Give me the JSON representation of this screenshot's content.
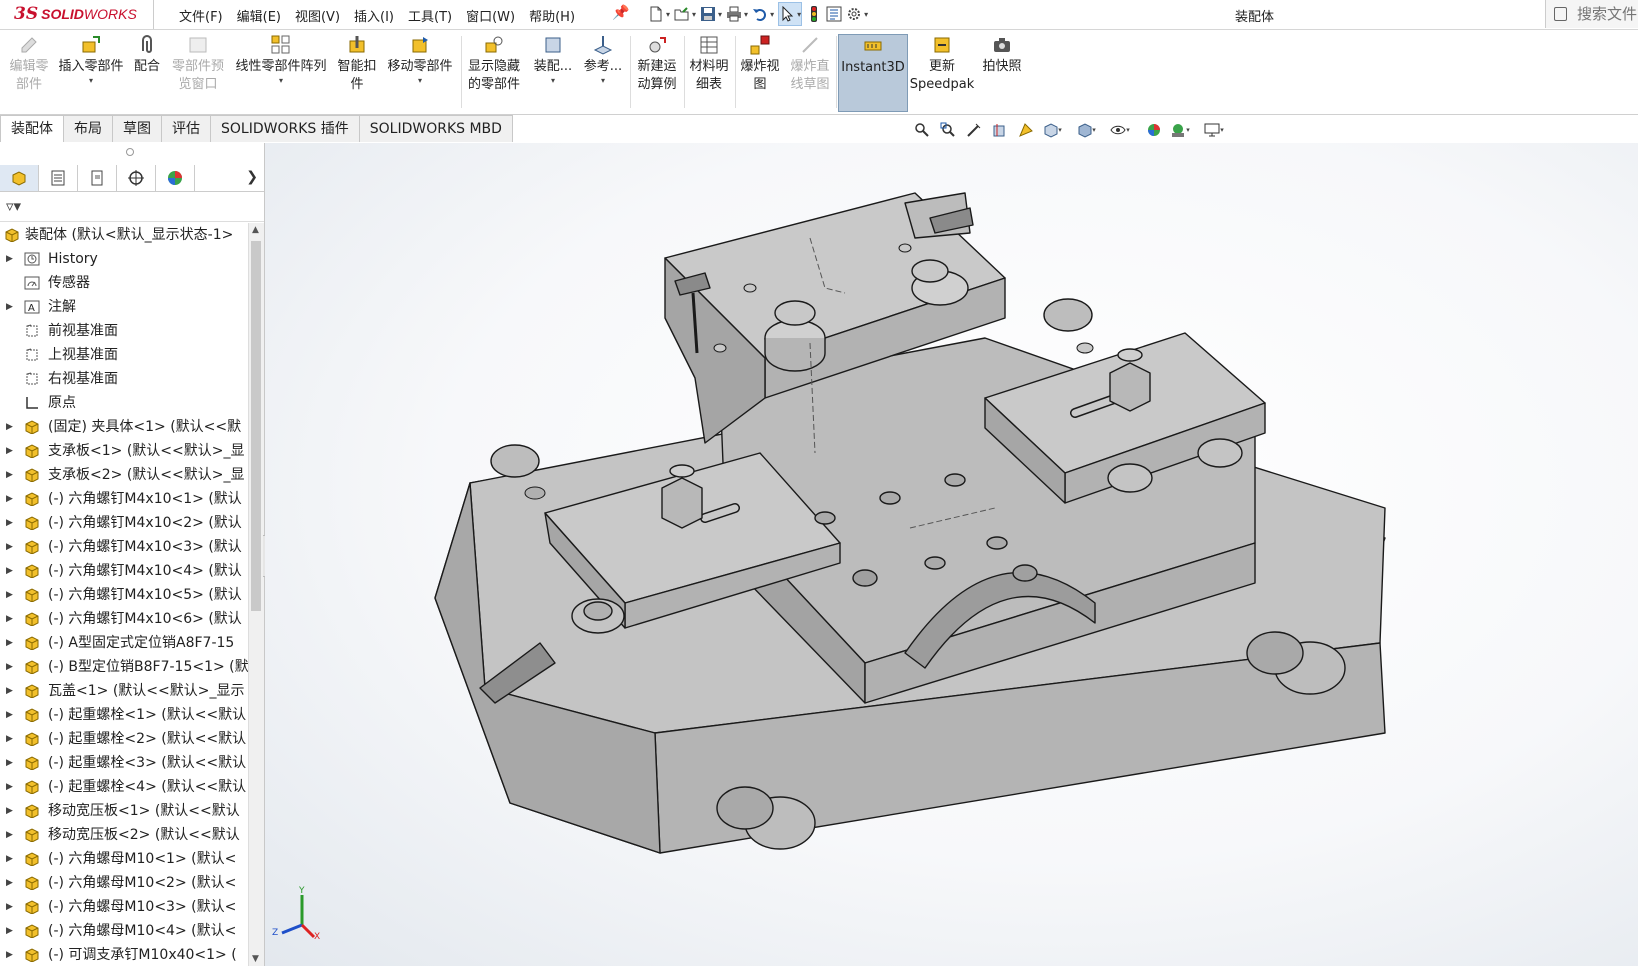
{
  "app": {
    "logo_ds": "3S",
    "logo_solid": "SOLID",
    "logo_works": "WORKS",
    "document_title": "装配体",
    "search_placeholder": "搜索文件"
  },
  "menu": [
    "文件(F)",
    "编辑(E)",
    "视图(V)",
    "插入(I)",
    "工具(T)",
    "窗口(W)",
    "帮助(H)"
  ],
  "quick_access": [
    {
      "name": "new-document-icon"
    },
    {
      "name": "open-icon"
    },
    {
      "name": "save-icon"
    },
    {
      "name": "print-icon"
    },
    {
      "name": "undo-icon"
    },
    {
      "name": "select-cursor-icon"
    },
    {
      "name": "rebuild-traffic-light-icon"
    },
    {
      "name": "file-properties-icon"
    },
    {
      "name": "options-gear-icon"
    }
  ],
  "ribbon": {
    "edit_component": [
      "编辑零",
      "部件"
    ],
    "insert_component": "插入零部件",
    "mate": "配合",
    "component_preview": [
      "零部件预",
      "览窗口"
    ],
    "linear_pattern": "线性零部件阵列",
    "smart_fasteners": [
      "智能扣",
      "件"
    ],
    "move_component": "移动零部件",
    "show_hidden": [
      "显示隐藏",
      "的零部件"
    ],
    "assembly_features": "装配...",
    "reference_geometry": "参考...",
    "new_motion_study": [
      "新建运",
      "动算例"
    ],
    "bill_of_materials": [
      "材料明",
      "细表"
    ],
    "exploded_view": [
      "爆炸视",
      "图"
    ],
    "explode_line_sketch": [
      "爆炸直",
      "线草图"
    ],
    "instant3d": "Instant3D",
    "update_speedpak": [
      "更新",
      "Speedpak"
    ],
    "take_snapshot": "拍快照"
  },
  "tabs": [
    "装配体",
    "布局",
    "草图",
    "评估",
    "SOLIDWORKS 插件",
    "SOLIDWORKS MBD"
  ],
  "tree": {
    "root": "装配体 (默认<默认_显示状态-1>",
    "items": [
      {
        "label": "History",
        "icon": "history-icon",
        "expandable": true
      },
      {
        "label": "传感器",
        "icon": "sensor-icon",
        "expandable": false
      },
      {
        "label": "注解",
        "icon": "annotation-icon",
        "expandable": true
      },
      {
        "label": "前视基准面",
        "icon": "plane-icon",
        "expandable": false
      },
      {
        "label": "上视基准面",
        "icon": "plane-icon",
        "expandable": false
      },
      {
        "label": "右视基准面",
        "icon": "plane-icon",
        "expandable": false
      },
      {
        "label": "原点",
        "icon": "origin-icon",
        "expandable": false
      },
      {
        "label": "(固定) 夹具体<1> (默认<<默",
        "icon": "part-icon",
        "expandable": true
      },
      {
        "label": "支承板<1> (默认<<默认>_显",
        "icon": "part-icon",
        "expandable": true
      },
      {
        "label": "支承板<2> (默认<<默认>_显",
        "icon": "part-icon",
        "expandable": true
      },
      {
        "label": "(-) 六角螺钉M4x10<1> (默认",
        "icon": "part-icon",
        "expandable": true
      },
      {
        "label": "(-) 六角螺钉M4x10<2> (默认",
        "icon": "part-icon",
        "expandable": true
      },
      {
        "label": "(-) 六角螺钉M4x10<3> (默认",
        "icon": "part-icon",
        "expandable": true
      },
      {
        "label": "(-) 六角螺钉M4x10<4> (默认",
        "icon": "part-icon",
        "expandable": true
      },
      {
        "label": "(-) 六角螺钉M4x10<5> (默认",
        "icon": "part-icon",
        "expandable": true
      },
      {
        "label": "(-) 六角螺钉M4x10<6> (默认",
        "icon": "part-icon",
        "expandable": true
      },
      {
        "label": "(-) A型固定式定位销A8F7-15",
        "icon": "part-icon",
        "expandable": true
      },
      {
        "label": "(-) B型定位销B8F7-15<1> (默",
        "icon": "part-icon",
        "expandable": true
      },
      {
        "label": "瓦盖<1> (默认<<默认>_显示",
        "icon": "part-icon",
        "expandable": true
      },
      {
        "label": "(-) 起重螺栓<1> (默认<<默认",
        "icon": "part-icon",
        "expandable": true
      },
      {
        "label": "(-) 起重螺栓<2> (默认<<默认",
        "icon": "part-icon",
        "expandable": true
      },
      {
        "label": "(-) 起重螺栓<3> (默认<<默认",
        "icon": "part-icon",
        "expandable": true
      },
      {
        "label": "(-) 起重螺栓<4> (默认<<默认",
        "icon": "part-icon",
        "expandable": true
      },
      {
        "label": "移动宽压板<1> (默认<<默认",
        "icon": "part-icon",
        "expandable": true
      },
      {
        "label": "移动宽压板<2> (默认<<默认",
        "icon": "part-icon",
        "expandable": true
      },
      {
        "label": "(-) 六角螺母M10<1> (默认<",
        "icon": "part-icon",
        "expandable": true
      },
      {
        "label": "(-) 六角螺母M10<2> (默认<",
        "icon": "part-icon",
        "expandable": true
      },
      {
        "label": "(-) 六角螺母M10<3> (默认<",
        "icon": "part-icon",
        "expandable": true
      },
      {
        "label": "(-) 六角螺母M10<4> (默认<",
        "icon": "part-icon",
        "expandable": true
      },
      {
        "label": "(-) 可调支承钉M10x40<1> (",
        "icon": "part-icon",
        "expandable": true
      }
    ]
  },
  "triad": {
    "x": "X",
    "y": "Y",
    "z": "Z"
  },
  "colors": {
    "brand_red": "#c8102e",
    "model_face": "#b5b5b5",
    "model_top": "#c4c4c4",
    "model_edge": "#1a1a1a",
    "part_icon_yellow": "#f2c02b",
    "active_button": "#b9c9da"
  }
}
